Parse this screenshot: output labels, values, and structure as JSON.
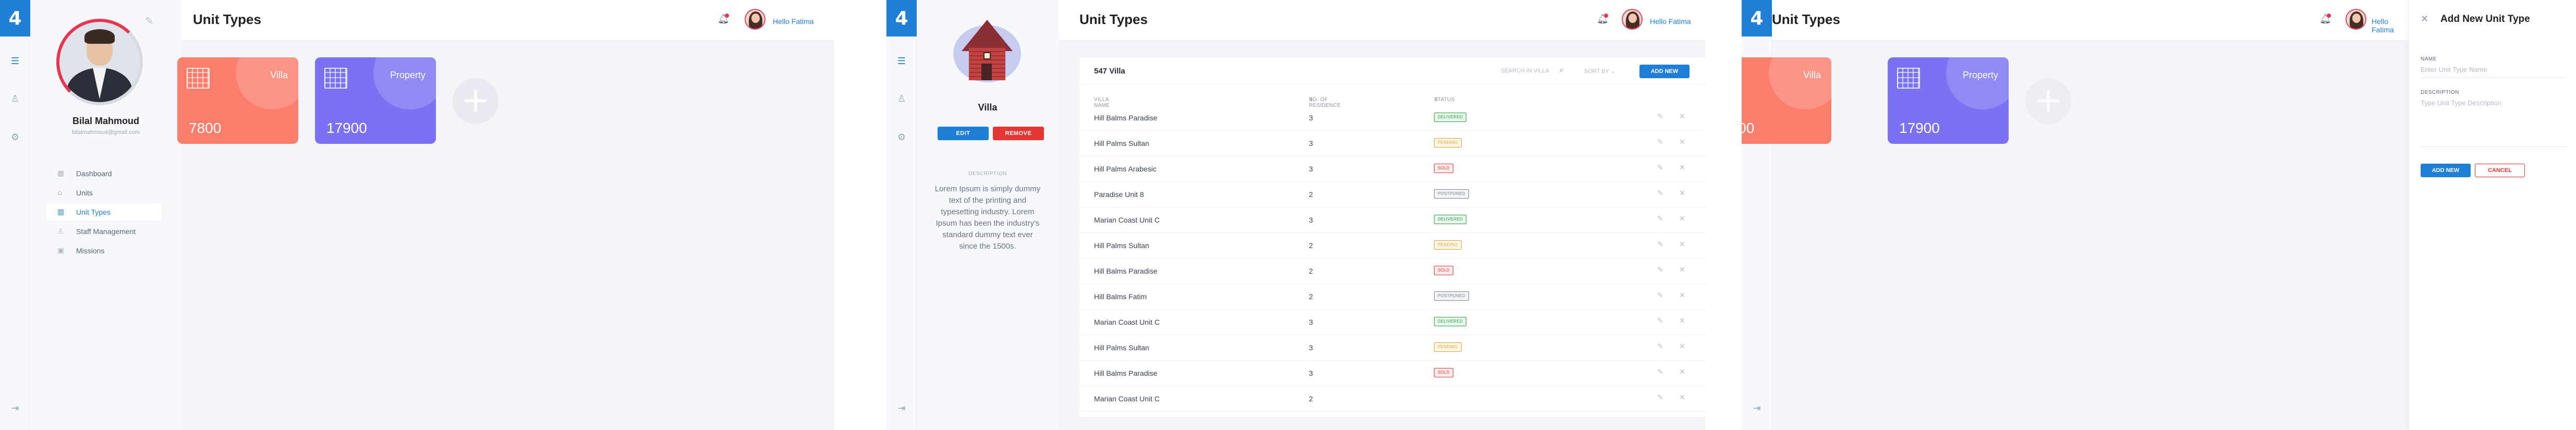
{
  "brand": {
    "logo": "4",
    "accent": "#1f7fd6",
    "danger": "#e53434"
  },
  "header": {
    "title": "Unit Types",
    "greeting": "Hello Fatima"
  },
  "profile": {
    "name": "Bilal Mahmoud",
    "email": "bilalmahmoud@gmail.com"
  },
  "nav": [
    {
      "label": "Dashboard",
      "icon": "grid-icon"
    },
    {
      "label": "Units",
      "icon": "home-icon"
    },
    {
      "label": "Unit Types",
      "icon": "building-icon",
      "active": true
    },
    {
      "label": "Staff Management",
      "icon": "user-icon"
    },
    {
      "label": "Missions",
      "icon": "briefcase-icon"
    }
  ],
  "cards": [
    {
      "title": "Villa",
      "value": "7800",
      "color": "#fb7d6c"
    },
    {
      "title": "Property",
      "value": "17900",
      "color": "#7b71f2"
    }
  ],
  "add_card": {
    "symbol": "+"
  },
  "detail": {
    "name": "Villa",
    "edit_label": "EDIT",
    "remove_label": "REMOVE",
    "description_label": "DESCRIPTION",
    "description": "Lorem Ipsum is simply dummy text of the printing and typesetting industry. Lorem Ipsum has been the industry's standard dummy text ever since the 1500s."
  },
  "table": {
    "count_label": "547 Villa",
    "search_placeholder": "SEARCH IN VILLA",
    "sort_label": "SORT BY",
    "add_label": "ADD NEW",
    "columns": [
      "VILLA NAME",
      "NO. OF RESIDENCE",
      "STATUS"
    ],
    "rows": [
      {
        "name": "Hill Balms Paradise",
        "residence": "3",
        "status": "DELIVERED",
        "kind": "delivered"
      },
      {
        "name": "Hill Palms Sultan",
        "residence": "3",
        "status": "PENDING",
        "kind": "pending"
      },
      {
        "name": "Hill Palms Arabesic",
        "residence": "3",
        "status": "SOLD",
        "kind": "sold"
      },
      {
        "name": "Paradise Unit 8",
        "residence": "2",
        "status": "POSTPONED",
        "kind": "postponed"
      },
      {
        "name": "Marian Coast Unit C",
        "residence": "3",
        "status": "DELIVERED",
        "kind": "delivered"
      },
      {
        "name": "Hill Palms Sultan",
        "residence": "2",
        "status": "PENDING",
        "kind": "pending"
      },
      {
        "name": "Hill Balms Paradise",
        "residence": "2",
        "status": "SOLD",
        "kind": "sold"
      },
      {
        "name": "Hill Balms Fatim",
        "residence": "2",
        "status": "POSTPONED",
        "kind": "postponed"
      },
      {
        "name": "Marian Coast Unit C",
        "residence": "3",
        "status": "DELIVERED",
        "kind": "delivered"
      },
      {
        "name": "Hill Palms Sultan",
        "residence": "3",
        "status": "PENDING",
        "kind": "pending"
      },
      {
        "name": "Hill Balms Paradise",
        "residence": "3",
        "status": "SOLD",
        "kind": "sold"
      },
      {
        "name": "Marian Coast Unit C",
        "residence": "2",
        "status": "",
        "kind": ""
      }
    ]
  },
  "drawer": {
    "title": "Add New Unit Type",
    "name_label": "NAME",
    "name_placeholder": "Enter Unit Type Name",
    "description_label": "DESCRIPTION",
    "description_placeholder": "Type Unit Type Description",
    "add_label": "ADD NEW",
    "cancel_label": "CANCEL"
  }
}
